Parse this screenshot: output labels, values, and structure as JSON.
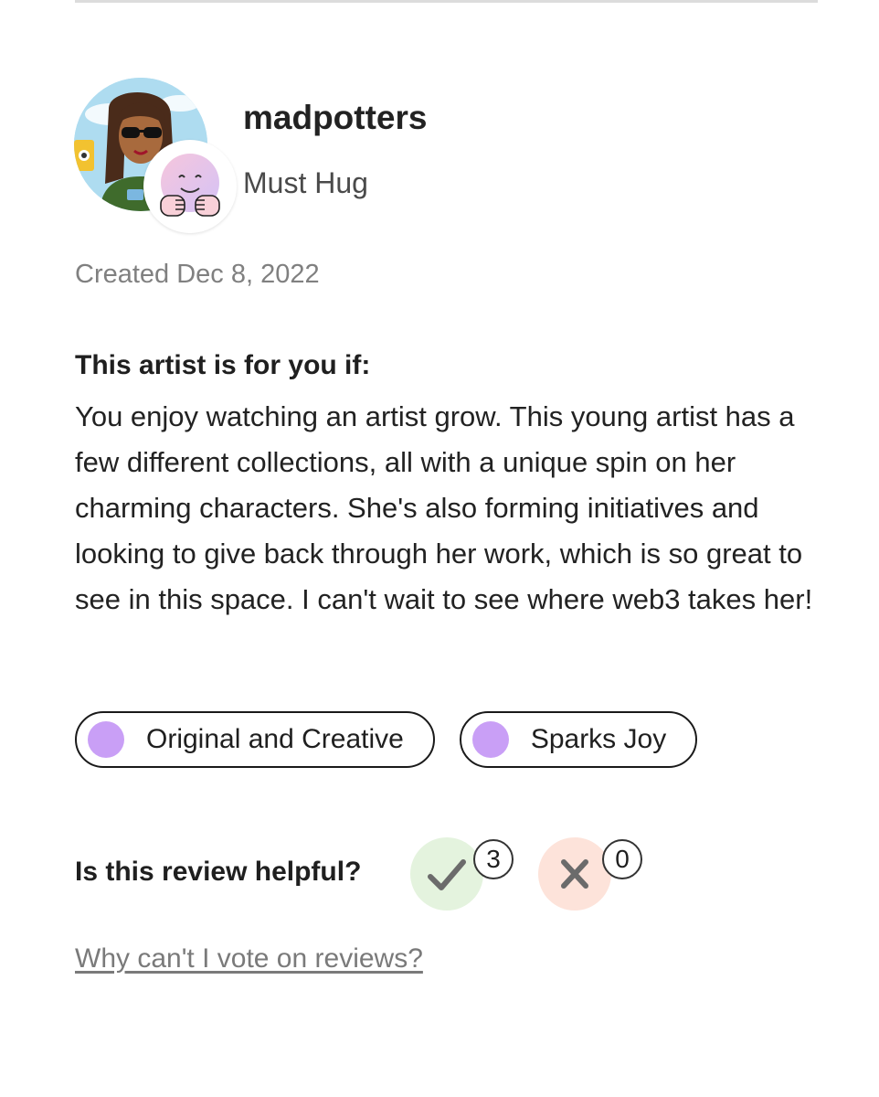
{
  "reviewer": {
    "username": "madpotters",
    "title": "Must Hug",
    "created": "Created Dec 8, 2022"
  },
  "review": {
    "heading": "This artist is for you if:",
    "body": "You enjoy watching an artist grow. This young artist has a few different collections, all with a unique spin on her charming characters. She's also forming initiatives and looking to give back through her work, which is so great to see in this space. I can't wait to see where web3 takes her!"
  },
  "tags": [
    {
      "label": "Original and Creative",
      "dot_color": "#c99ff6"
    },
    {
      "label": "Sparks Joy",
      "dot_color": "#c99ff6"
    }
  ],
  "helpful": {
    "question": "Is this review helpful?",
    "yes_count": "3",
    "no_count": "0",
    "yes_icon": "check-icon",
    "no_icon": "x-icon",
    "link": "Why can't I vote on reviews?"
  },
  "colors": {
    "tag_dot": "#c99ff6",
    "yes_bg": "#e4f3de",
    "no_bg": "#fde3da",
    "link": "#7a7a7a"
  }
}
